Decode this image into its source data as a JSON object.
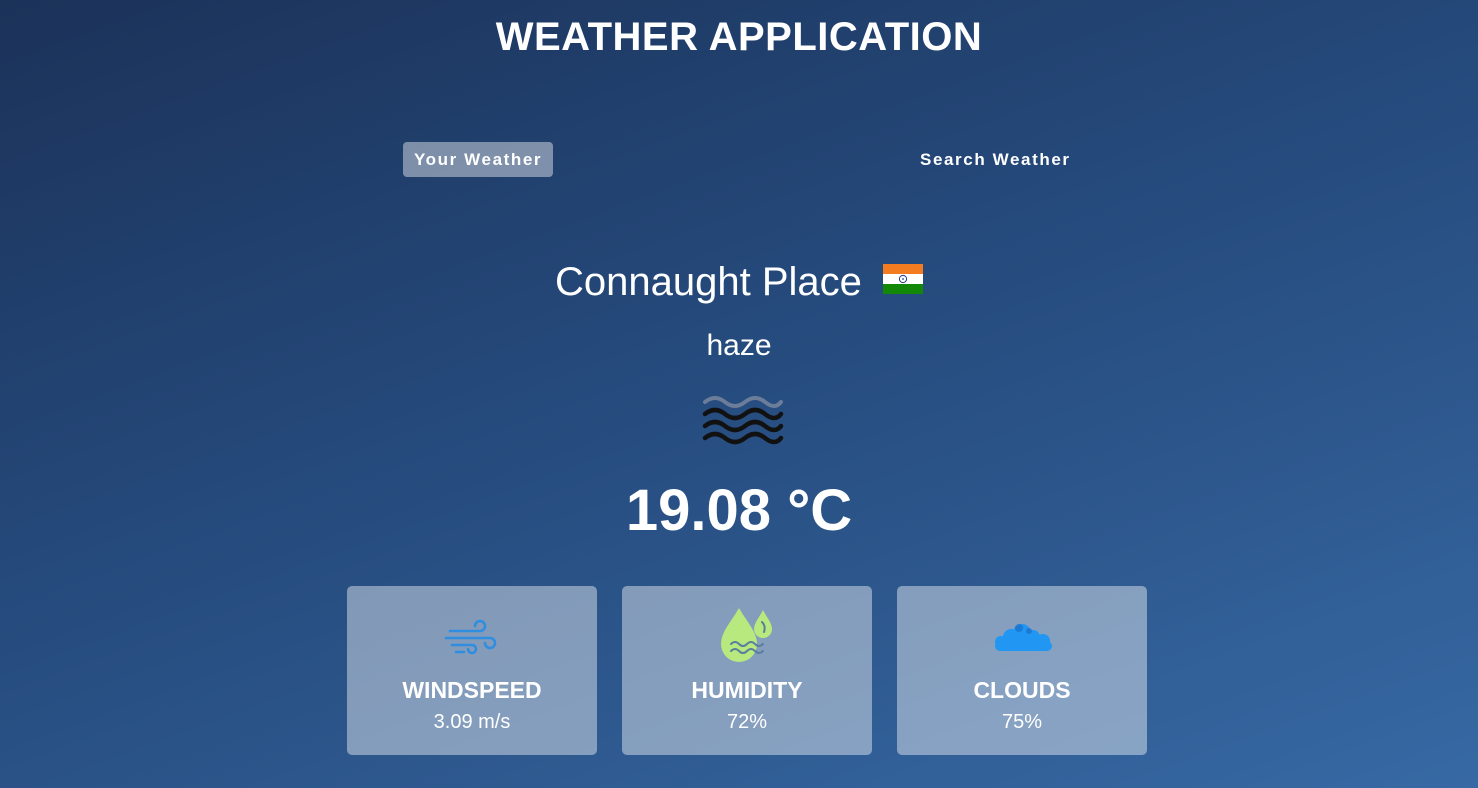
{
  "app": {
    "title": "WEATHER APPLICATION"
  },
  "tabs": [
    {
      "label": "Your Weather",
      "active": true
    },
    {
      "label": "Search Weather",
      "active": false
    }
  ],
  "location": {
    "city": "Connaught Place",
    "country_flag_icon": "india-flag-icon"
  },
  "current": {
    "condition": "haze",
    "condition_icon": "haze-icon",
    "temperature": "19.08 °C"
  },
  "stats": [
    {
      "label": "WINDSPEED",
      "value": "3.09 m/s",
      "icon": "wind-icon"
    },
    {
      "label": "HUMIDITY",
      "value": "72%",
      "icon": "humidity-icon"
    },
    {
      "label": "CLOUDS",
      "value": "75%",
      "icon": "clouds-icon"
    }
  ],
  "colors": {
    "background_top": "#1b3259",
    "background_bottom": "#3769a4",
    "card_background": "rgba(255,255,255,0.42)",
    "wind_icon": "#2f8ee0",
    "humidity_icon": "#b7e97e",
    "clouds_icon": "#2196f3"
  }
}
